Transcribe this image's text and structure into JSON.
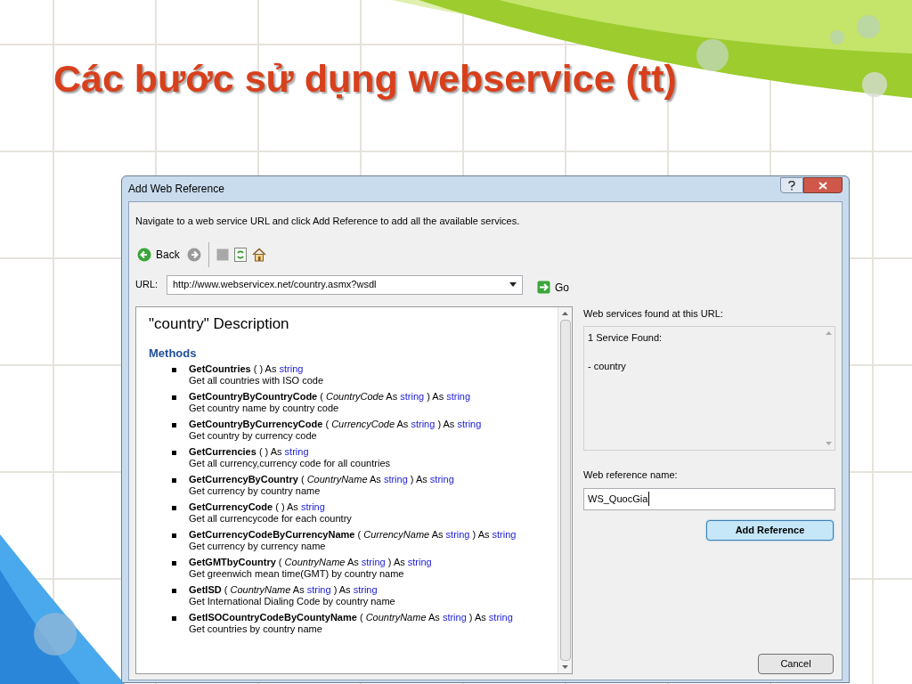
{
  "slide_title": "Các bước sử dụng webservice (tt)",
  "dialog": {
    "title": "Add Web Reference",
    "instructions": "Navigate to a web service URL and click Add Reference to add all the available services.",
    "toolbar": {
      "back": "Back"
    },
    "url_label": "URL:",
    "url": "http://www.webservicex.net/country.asmx?wsdl",
    "go": "Go",
    "description": {
      "heading": "\"country\" Description",
      "section": "Methods",
      "methods": [
        {
          "signature": [
            {
              "kind": "method",
              "text": "GetCountries"
            },
            {
              "kind": "plain",
              "text": "( ) As"
            },
            {
              "kind": "type",
              "text": "string"
            }
          ],
          "summary": "Get all countries with ISO code"
        },
        {
          "signature": [
            {
              "kind": "method",
              "text": "GetCountryByCountryCode"
            },
            {
              "kind": "plain",
              "text": "("
            },
            {
              "kind": "param",
              "text": "CountryCode"
            },
            {
              "kind": "plain",
              "text": "As"
            },
            {
              "kind": "type",
              "text": "string"
            },
            {
              "kind": "plain",
              "text": ") As"
            },
            {
              "kind": "type",
              "text": "string"
            }
          ],
          "summary": "Get country name by country code"
        },
        {
          "signature": [
            {
              "kind": "method",
              "text": "GetCountryByCurrencyCode"
            },
            {
              "kind": "plain",
              "text": "("
            },
            {
              "kind": "param",
              "text": "CurrencyCode"
            },
            {
              "kind": "plain",
              "text": "As"
            },
            {
              "kind": "type",
              "text": "string"
            },
            {
              "kind": "plain",
              "text": ") As"
            },
            {
              "kind": "type",
              "text": "string"
            }
          ],
          "summary": "Get country by currency code"
        },
        {
          "signature": [
            {
              "kind": "method",
              "text": "GetCurrencies"
            },
            {
              "kind": "plain",
              "text": "( ) As"
            },
            {
              "kind": "type",
              "text": "string"
            }
          ],
          "summary": "Get all currency,currency code for all countries"
        },
        {
          "signature": [
            {
              "kind": "method",
              "text": "GetCurrencyByCountry"
            },
            {
              "kind": "plain",
              "text": "("
            },
            {
              "kind": "param",
              "text": "CountryName"
            },
            {
              "kind": "plain",
              "text": "As"
            },
            {
              "kind": "type",
              "text": "string"
            },
            {
              "kind": "plain",
              "text": ") As"
            },
            {
              "kind": "type",
              "text": "string"
            }
          ],
          "summary": "Get currency by country name"
        },
        {
          "signature": [
            {
              "kind": "method",
              "text": "GetCurrencyCode"
            },
            {
              "kind": "plain",
              "text": "( ) As"
            },
            {
              "kind": "type",
              "text": "string"
            }
          ],
          "summary": "Get all currencycode for each country"
        },
        {
          "signature": [
            {
              "kind": "method",
              "text": "GetCurrencyCodeByCurrencyName"
            },
            {
              "kind": "plain",
              "text": "("
            },
            {
              "kind": "param",
              "text": "CurrencyName"
            },
            {
              "kind": "plain",
              "text": "As"
            },
            {
              "kind": "type",
              "text": "string"
            },
            {
              "kind": "plain",
              "text": ") As"
            },
            {
              "kind": "type",
              "text": "string"
            }
          ],
          "summary": "Get currency by currency name"
        },
        {
          "signature": [
            {
              "kind": "method",
              "text": "GetGMTbyCountry"
            },
            {
              "kind": "plain",
              "text": "("
            },
            {
              "kind": "param",
              "text": "CountryName"
            },
            {
              "kind": "plain",
              "text": "As"
            },
            {
              "kind": "type",
              "text": "string"
            },
            {
              "kind": "plain",
              "text": ") As"
            },
            {
              "kind": "type",
              "text": "string"
            }
          ],
          "summary": "Get greenwich mean time(GMT) by country name"
        },
        {
          "signature": [
            {
              "kind": "method",
              "text": "GetISD"
            },
            {
              "kind": "plain",
              "text": "("
            },
            {
              "kind": "param",
              "text": "CountryName"
            },
            {
              "kind": "plain",
              "text": "As"
            },
            {
              "kind": "type",
              "text": "string"
            },
            {
              "kind": "plain",
              "text": ") As"
            },
            {
              "kind": "type",
              "text": "string"
            }
          ],
          "summary": "Get International Dialing Code by country name"
        },
        {
          "signature": [
            {
              "kind": "method",
              "text": "GetISOCountryCodeByCountyName"
            },
            {
              "kind": "plain",
              "text": "("
            },
            {
              "kind": "param",
              "text": "CountryName"
            },
            {
              "kind": "plain",
              "text": "As"
            },
            {
              "kind": "type",
              "text": "string"
            },
            {
              "kind": "plain",
              "text": ") As"
            },
            {
              "kind": "type",
              "text": "string"
            }
          ],
          "summary": "Get countries by country name"
        }
      ]
    },
    "found_label": "Web services found at this URL:",
    "found_lines": [
      "1 Service Found:",
      "- country"
    ],
    "ref_name_label": "Web reference name:",
    "ref_name": "WS_QuocGia",
    "add_button": "Add Reference",
    "cancel_button": "Cancel"
  }
}
